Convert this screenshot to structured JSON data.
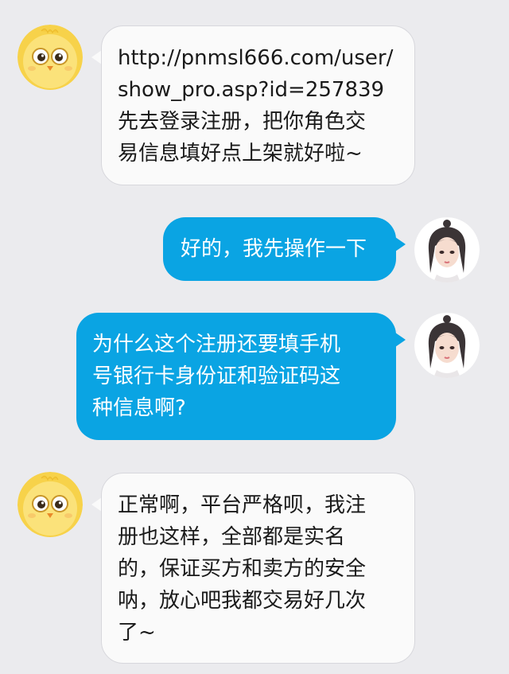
{
  "messages": [
    {
      "side": "incoming",
      "avatar": "chick-avatar",
      "lines": [
        "http://pnmsl666.com/user/",
        "show_pro.asp?id=257839",
        "先去登录注册，把你角色交",
        "易信息填好点上架就好啦~"
      ]
    },
    {
      "side": "outgoing",
      "avatar": "girl-avatar",
      "lines": [
        "好的，我先操作一下"
      ]
    },
    {
      "side": "outgoing",
      "avatar": "girl-avatar",
      "lines": [
        "为什么这个注册还要填手机",
        "号银行卡身份证和验证码这",
        "种信息啊?"
      ]
    },
    {
      "side": "incoming",
      "avatar": "chick-avatar",
      "lines": [
        "正常啊，平台严格呗，我注",
        "册也这样，全部都是实名",
        "的，保证买方和卖方的安全",
        "呐，放心吧我都交易好几次",
        "了~"
      ]
    }
  ],
  "colors": {
    "background": "#ebebee",
    "incoming_bubble": "#fafafa",
    "outgoing_bubble": "#0aa4e3"
  }
}
